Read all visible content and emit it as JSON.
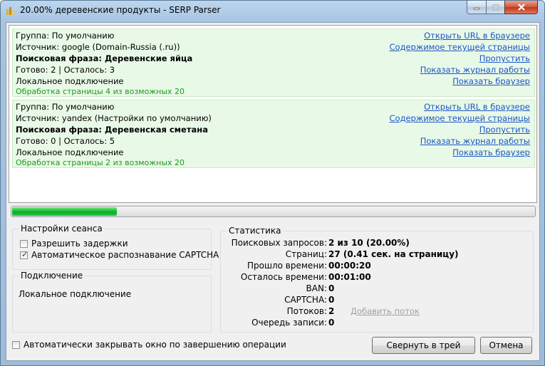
{
  "window": {
    "title": "20.00% деревенские продукты - SERP Parser"
  },
  "tasks": [
    {
      "group": "Группа: По умолчанию",
      "source": "Источник: google (Domain-Russia (.ru))",
      "phrase": "Поисковая фраза: Деревенские яйца",
      "done": "Готово: 2 | Осталось: 3",
      "connection": "Локальное подключение",
      "progress": "Обработка страницы 4 из возможных 20",
      "links": [
        "Открыть URL в браузере",
        "Содержимое текущей страницы",
        "Пропустить",
        "Показать журнал работы",
        "Показать браузер"
      ]
    },
    {
      "group": "Группа: По умолчанию",
      "source": "Источник: yandex (Настройки по умолчанию)",
      "phrase": "Поисковая фраза: Деревенская сметана",
      "done": "Готово: 0 | Осталось: 5",
      "connection": "Локальное подключение",
      "progress": "Обработка страницы 2 из возможных 20",
      "links": [
        "Открыть URL в браузере",
        "Содержимое текущей страницы",
        "Пропустить",
        "Показать журнал работы",
        "Показать браузер"
      ]
    }
  ],
  "overall_progress": 0.2,
  "session": {
    "title": "Настройки сеанса",
    "allow_delays": "Разрешить задержки",
    "allow_delays_checked": false,
    "captcha": "Автоматическое распознавание CAPTCHA",
    "captcha_checked": true
  },
  "connection": {
    "title": "Подключение",
    "value": "Локальное подключение"
  },
  "stats": {
    "title": "Статистика",
    "rows": [
      {
        "label": "Поисковых запросов:",
        "value": "2 из 10 (20.00%)"
      },
      {
        "label": "Страниц:",
        "value": "27 (0.41 сек. на страницу)"
      },
      {
        "label": "Прошло времени:",
        "value": "00:00:20"
      },
      {
        "label": "Осталось времени:",
        "value": "00:01:00"
      },
      {
        "label": "BAN:",
        "value": "0"
      },
      {
        "label": "CAPTCHA:",
        "value": "0"
      },
      {
        "label": "Потоков:",
        "value": "2"
      },
      {
        "label": "Очередь записи:",
        "value": "0"
      }
    ],
    "add_thread": "Добавить поток"
  },
  "footer": {
    "auto_close": "Автоматически закрывать окно по завершению операции",
    "auto_close_checked": false,
    "minimize_button": "Свернуть в трей",
    "cancel_button": "Отмена"
  },
  "colors": {
    "progress_text": "#1e9a1e",
    "link": "#1a56c8",
    "progress_fill": "#06b025",
    "task_background": "#e9f9e7"
  }
}
